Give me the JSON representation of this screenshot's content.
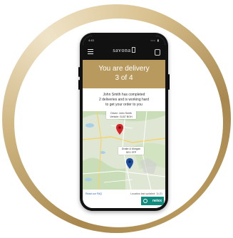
{
  "brand": {
    "ring_color": "#b89a5e",
    "logo_text": "savona"
  },
  "status_bar": {
    "time": "4:43",
    "signal": "••• ▮"
  },
  "app_bar": {
    "menu_icon": "hamburger-icon",
    "account_icon": "account-icon"
  },
  "banner": {
    "line1": "You are delivery",
    "line2": "3 of 4",
    "color": "#b89a5e"
  },
  "message": {
    "line1": "John Smith has completed",
    "line2": "2 deliveries and is working hard",
    "line3": "to get your order to you"
  },
  "map": {
    "driver": {
      "line1": "Driver: John Smith",
      "line2": "Vehicle: GL67 BOH",
      "pin_color": "#d7262a"
    },
    "destination": {
      "line1": "Drake & Morgan",
      "line2": "SE1 9TP",
      "pin_color": "#1c4fa0"
    }
  },
  "footer": {
    "faq_link": "Read our FAQ",
    "updated": "Location last updated: 11:21",
    "partner": "netex",
    "partner_color": "#0f8c7e"
  }
}
